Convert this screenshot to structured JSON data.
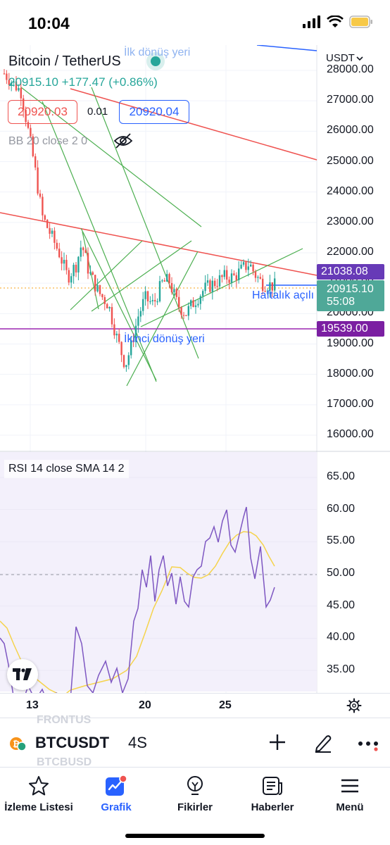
{
  "status_bar": {
    "time": "10:04"
  },
  "chart": {
    "symbol_title": "Bitcoin / TetherUS",
    "price_change": "20915.10 +177.47 (+0.86%)",
    "bid": "20920.03",
    "spread": "0.01",
    "ask": "20920.04",
    "indicator_label": "BB 20 close 2 0",
    "currency": "USDT",
    "price_axis": [
      "28000.00",
      "27000.00",
      "26000.00",
      "25000.00",
      "24000.00",
      "23000.00",
      "22000.00",
      "21000.00",
      "20000.00",
      "19000.00",
      "18000.00",
      "17000.00",
      "16000.00"
    ],
    "badges": {
      "upper": "21038.08",
      "current_price": "20915.10",
      "countdown": "55:08",
      "lower": "19539.00"
    },
    "annotations": {
      "top": "İlk dönüş yeri",
      "second": "İkinci dönüş yeri",
      "weekly": "Haftalık açılı"
    },
    "colors": {
      "up": "#26a69a",
      "down": "#ef5350",
      "trendline_red": "#ef5350",
      "trendline_green": "#4caf50",
      "support": "#9c27b0"
    }
  },
  "rsi": {
    "label": "RSI 14 close SMA 14 2",
    "axis": [
      "65.00",
      "60.00",
      "55.00",
      "50.00",
      "45.00",
      "40.00",
      "35.00"
    ]
  },
  "time_axis": {
    "ticks": [
      "13",
      "20",
      "25"
    ]
  },
  "symbol_bar": {
    "ghost_top": "FRONTUS",
    "ghost_bottom": "BTCBUSD",
    "symbol": "BTCUSDT",
    "interval": "4S"
  },
  "nav": {
    "watchlist": "İzleme Listesi",
    "chart": "Grafik",
    "ideas": "Fikirler",
    "news": "Haberler",
    "menu": "Menü"
  }
}
